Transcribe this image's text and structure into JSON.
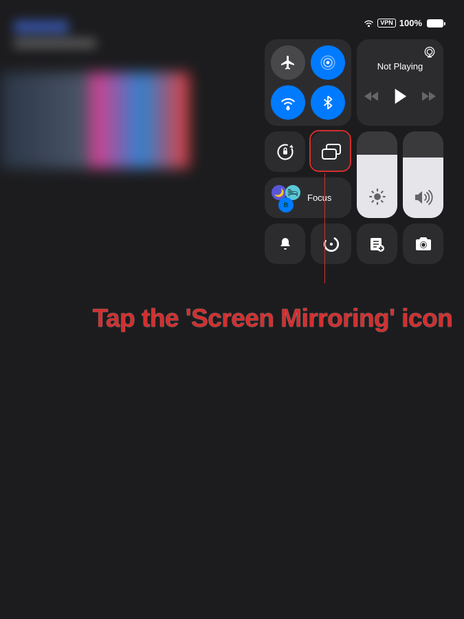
{
  "status": {
    "vpn": "VPN",
    "battery_pct": "100%"
  },
  "connectivity": {
    "airplane_active": false,
    "airdrop_active": true,
    "wifi_active": true,
    "bluetooth_active": true
  },
  "media": {
    "title": "Not Playing"
  },
  "focus": {
    "label": "Focus"
  },
  "sliders": {
    "brightness_pct": 73,
    "volume_pct": 70
  },
  "annotation": {
    "text": "Tap the 'Screen Mirroring' icon"
  },
  "colors": {
    "accent": "#007aff",
    "highlight": "#d32f2f",
    "tile_bg": "#2c2c2e"
  }
}
